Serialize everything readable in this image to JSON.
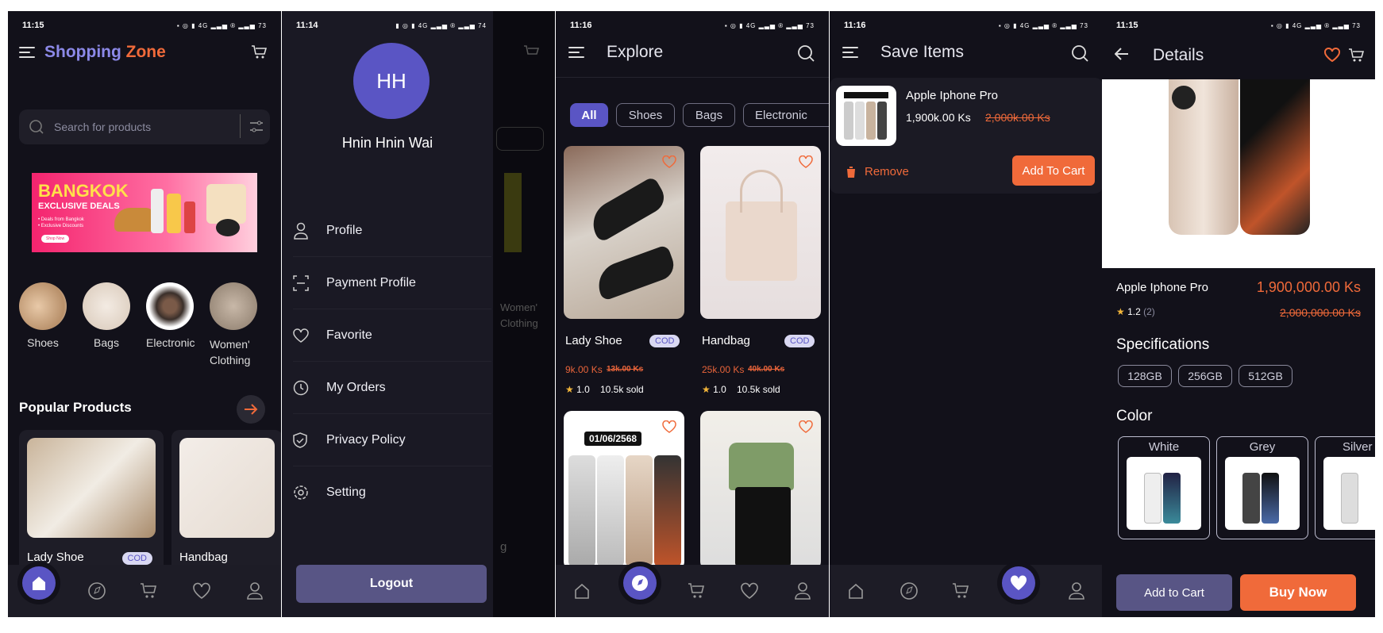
{
  "colors": {
    "accent": "#5a55c4",
    "orange": "#f06a3a",
    "bg": "#12111a",
    "gradient_start": "#8c89e8",
    "gradient_end": "#f06a3a"
  },
  "screen1": {
    "time": "11:15",
    "battery": "73",
    "app_title_1": "Shopping",
    "app_title_2": "Zone",
    "search_placeholder": "Search for products",
    "banner": {
      "line1": "BANGKOK",
      "line2": "EXCLUSIVE DEALS",
      "bullet1": "• Deals from Bangkok",
      "bullet2": "• Exclusive Discounts",
      "cta": "Shop Now"
    },
    "categories": [
      {
        "label": "Shoes"
      },
      {
        "label": "Bags"
      },
      {
        "label": "Electronic"
      },
      {
        "label": "Women' Clothing"
      }
    ],
    "section_title": "Popular Products",
    "products": [
      {
        "name": "Lady Shoe",
        "badge": "COD"
      },
      {
        "name": "Handbag"
      }
    ]
  },
  "screen2": {
    "time": "11:14",
    "battery": "74",
    "avatar_initials": "HH",
    "user_name": "Hnin Hnin Wai",
    "menu": [
      {
        "label": "Profile"
      },
      {
        "label": "Payment Profile"
      },
      {
        "label": "Favorite"
      },
      {
        "label": "My Orders"
      },
      {
        "label": "Privacy Policy"
      },
      {
        "label": "Setting"
      }
    ],
    "logout": "Logout",
    "bg_category_label": "Women' Clothing",
    "bg_product_tail": "g"
  },
  "screen3": {
    "time": "11:16",
    "battery": "73",
    "title": "Explore",
    "chips": [
      {
        "label": "All"
      },
      {
        "label": "Shoes"
      },
      {
        "label": "Bags"
      },
      {
        "label": "Electronic"
      }
    ],
    "products": [
      {
        "name": "Lady Shoe",
        "badge": "COD",
        "price": "9k.00 Ks",
        "old_price": "13k.00 Ks",
        "rating": "1.0",
        "sold": "10.5k sold"
      },
      {
        "name": "Handbag",
        "badge": "COD",
        "price": "25k.00 Ks",
        "old_price": "40k.00 Ks",
        "rating": "1.0",
        "sold": "10.5k sold"
      }
    ],
    "date_banner": "01/06/2568"
  },
  "screen4": {
    "time": "11:16",
    "battery": "73",
    "title": "Save Items",
    "item": {
      "name": "Apple Iphone Pro",
      "price": "1,900k.00 Ks",
      "old_price": "2,000k.00 Ks"
    },
    "remove": "Remove",
    "add_to_cart": "Add To Cart"
  },
  "screen5": {
    "time": "11:15",
    "battery": "73",
    "title": "Details",
    "product_name": "Apple Iphone Pro",
    "price": "1,900,000.00 Ks",
    "old_price": "2,000,000.00 Ks",
    "rating": "1.2",
    "rating_count": "(2)",
    "spec_title": "Specifications",
    "specs": [
      {
        "label": "128GB"
      },
      {
        "label": "256GB"
      },
      {
        "label": "512GB"
      }
    ],
    "color_title": "Color",
    "colors": [
      {
        "label": "White"
      },
      {
        "label": "Grey"
      },
      {
        "label": "Silver"
      }
    ],
    "add_to_cart": "Add to Cart",
    "buy_now": "Buy Now"
  }
}
